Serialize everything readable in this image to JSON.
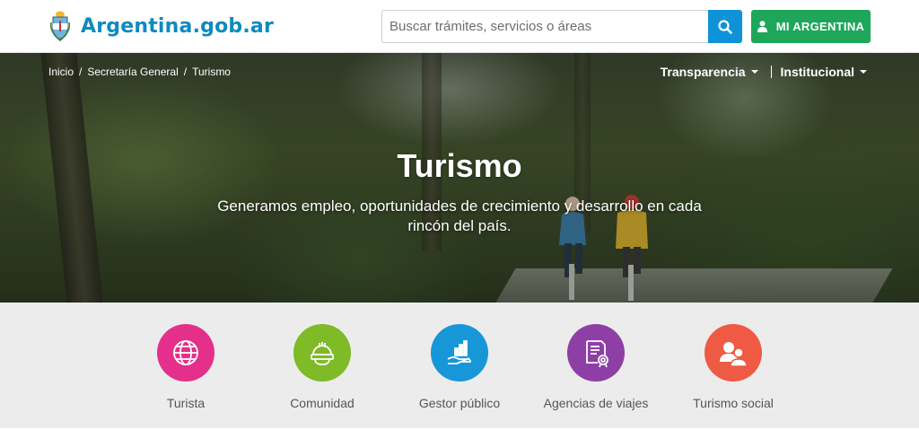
{
  "header": {
    "logo_text": "Argentina.gob.ar",
    "search_placeholder": "Buscar trámites, servicios o áreas",
    "mi_argentina_label": "MI ARGENTINA"
  },
  "breadcrumb": [
    "Inicio",
    "Secretaría General",
    "Turismo"
  ],
  "topnav": {
    "transparencia": "Transparencia",
    "institucional": "Institucional"
  },
  "hero": {
    "title": "Turismo",
    "subtitle": "Generamos empleo, oportunidades de crecimiento y desarrollo en cada rincón del país."
  },
  "categories": [
    {
      "label": "Turista",
      "icon": "globe-icon",
      "color": "#e4308a"
    },
    {
      "label": "Comunidad",
      "icon": "hardhat-icon",
      "color": "#7fba27"
    },
    {
      "label": "Gestor público",
      "icon": "hand-chart-icon",
      "color": "#1797d8"
    },
    {
      "label": "Agencias de viajes",
      "icon": "certificate-icon",
      "color": "#8e3fa6"
    },
    {
      "label": "Turismo social",
      "icon": "people-icon",
      "color": "#ee5a44"
    }
  ],
  "colors": {
    "brand_blue": "#0c8bbd",
    "search_button": "#0e93d9",
    "mi_argentina_green": "#1ea75a"
  }
}
